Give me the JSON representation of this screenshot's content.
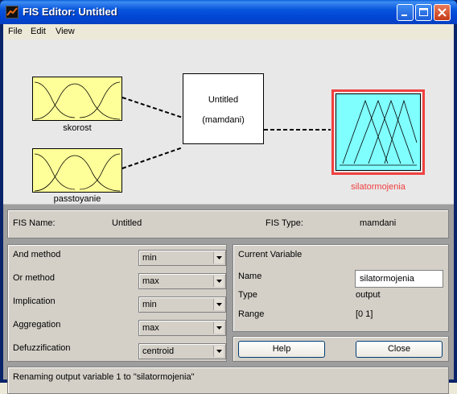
{
  "window": {
    "title": "FIS Editor: Untitled"
  },
  "menu": {
    "file": "File",
    "edit": "Edit",
    "view": "View"
  },
  "diagram": {
    "inputs": [
      {
        "name": "skorost"
      },
      {
        "name": "passtoyanie"
      }
    ],
    "system": {
      "name": "Untitled",
      "type": "(mamdani)"
    },
    "output": {
      "name": "silatormojenia"
    },
    "colors": {
      "input_fill": "#ffff99",
      "output_fill": "#80ffff",
      "output_border": "#f04040",
      "output_label": "#f04040"
    }
  },
  "info": {
    "fis_name_label": "FIS Name:",
    "fis_name_value": "Untitled",
    "fis_type_label": "FIS Type:",
    "fis_type_value": "mamdani"
  },
  "methods": [
    {
      "label": "And method",
      "value": "min"
    },
    {
      "label": "Or method",
      "value": "max"
    },
    {
      "label": "Implication",
      "value": "min"
    },
    {
      "label": "Aggregation",
      "value": "max"
    },
    {
      "label": "Defuzzification",
      "value": "centroid"
    }
  ],
  "current_variable": {
    "heading": "Current Variable",
    "name_label": "Name",
    "name_value": "silatormojenia",
    "type_label": "Type",
    "type_value": "output",
    "range_label": "Range",
    "range_value": "[0 1]"
  },
  "buttons": {
    "help": "Help",
    "close": "Close"
  },
  "status": "Renaming output variable 1 to \"silatormojenia\""
}
